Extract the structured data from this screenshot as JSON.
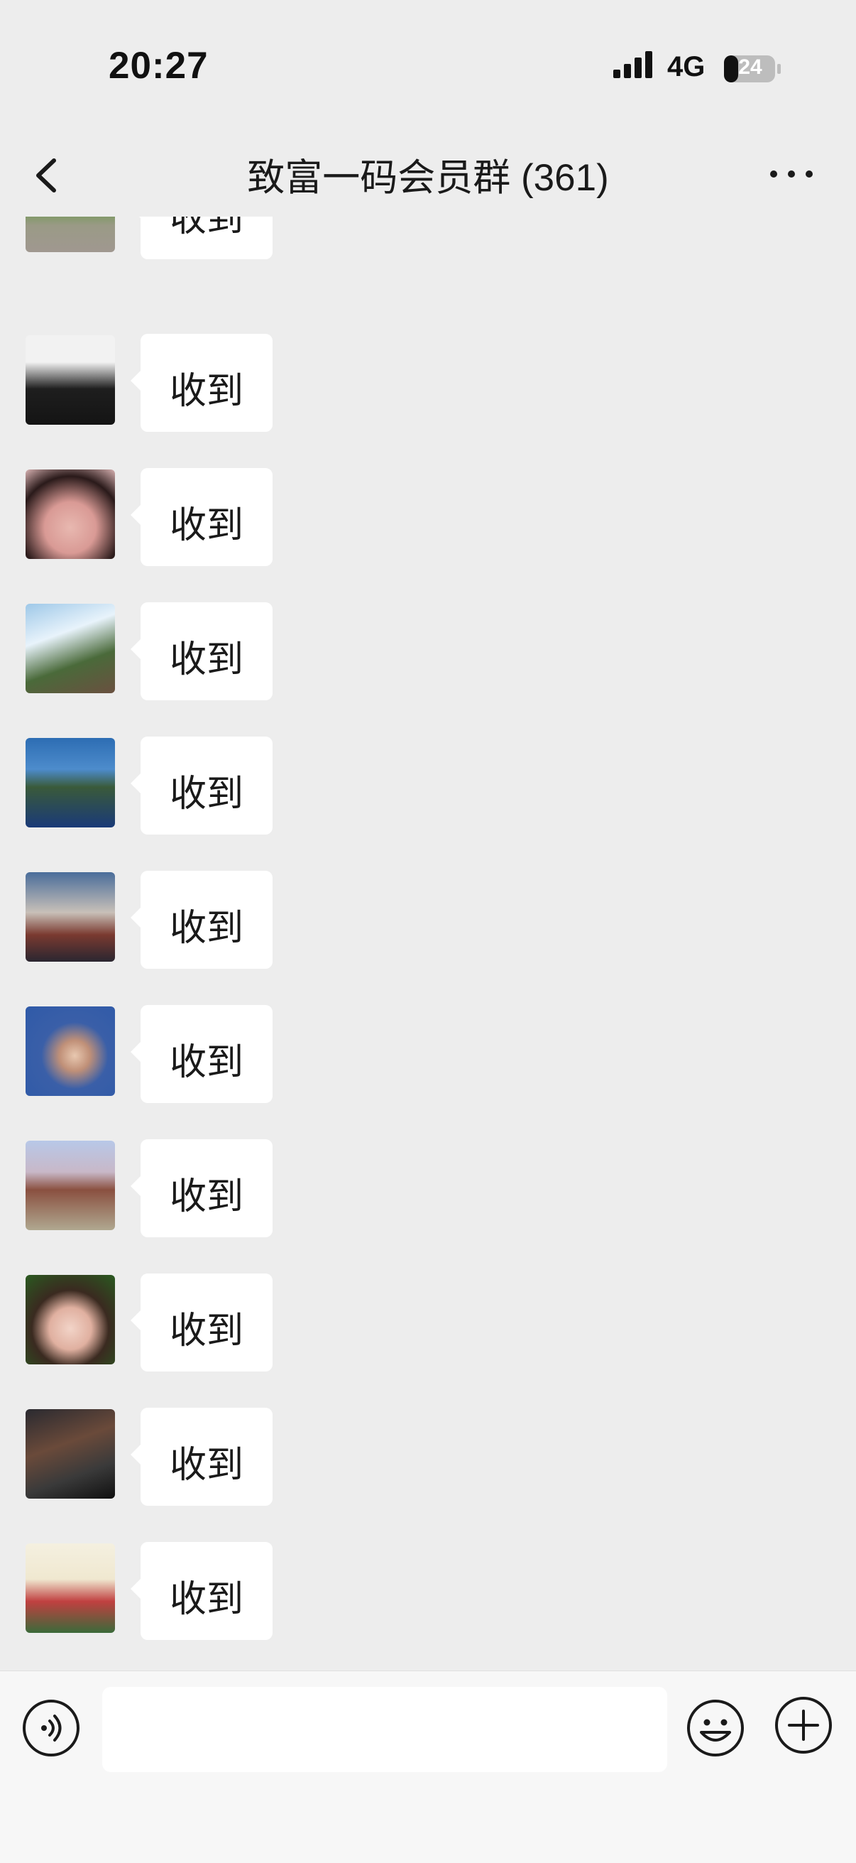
{
  "status_bar": {
    "time": "20:27",
    "network": "4G",
    "battery": "24",
    "icons": [
      "signal-icon",
      "battery-icon"
    ]
  },
  "nav": {
    "title": "致富一码会员群 (361)",
    "back_icon": "chevron-left-icon",
    "more_icon": "more-dots-icon"
  },
  "messages": [
    {
      "text": "收到"
    },
    {
      "text": "收到"
    },
    {
      "text": "收到"
    },
    {
      "text": "收到"
    },
    {
      "text": "收到"
    },
    {
      "text": "收到"
    },
    {
      "text": "收到"
    },
    {
      "text": "收到"
    },
    {
      "text": "收到"
    },
    {
      "text": "收到"
    },
    {
      "text": "收到"
    }
  ],
  "input_bar": {
    "value": "",
    "icons": [
      "voice-icon",
      "emoji-icon",
      "plus-icon"
    ]
  },
  "colors": {
    "background": "#ededed",
    "bubble": "#ffffff",
    "input_bar": "#f7f7f7",
    "text": "#1a1a1a"
  }
}
